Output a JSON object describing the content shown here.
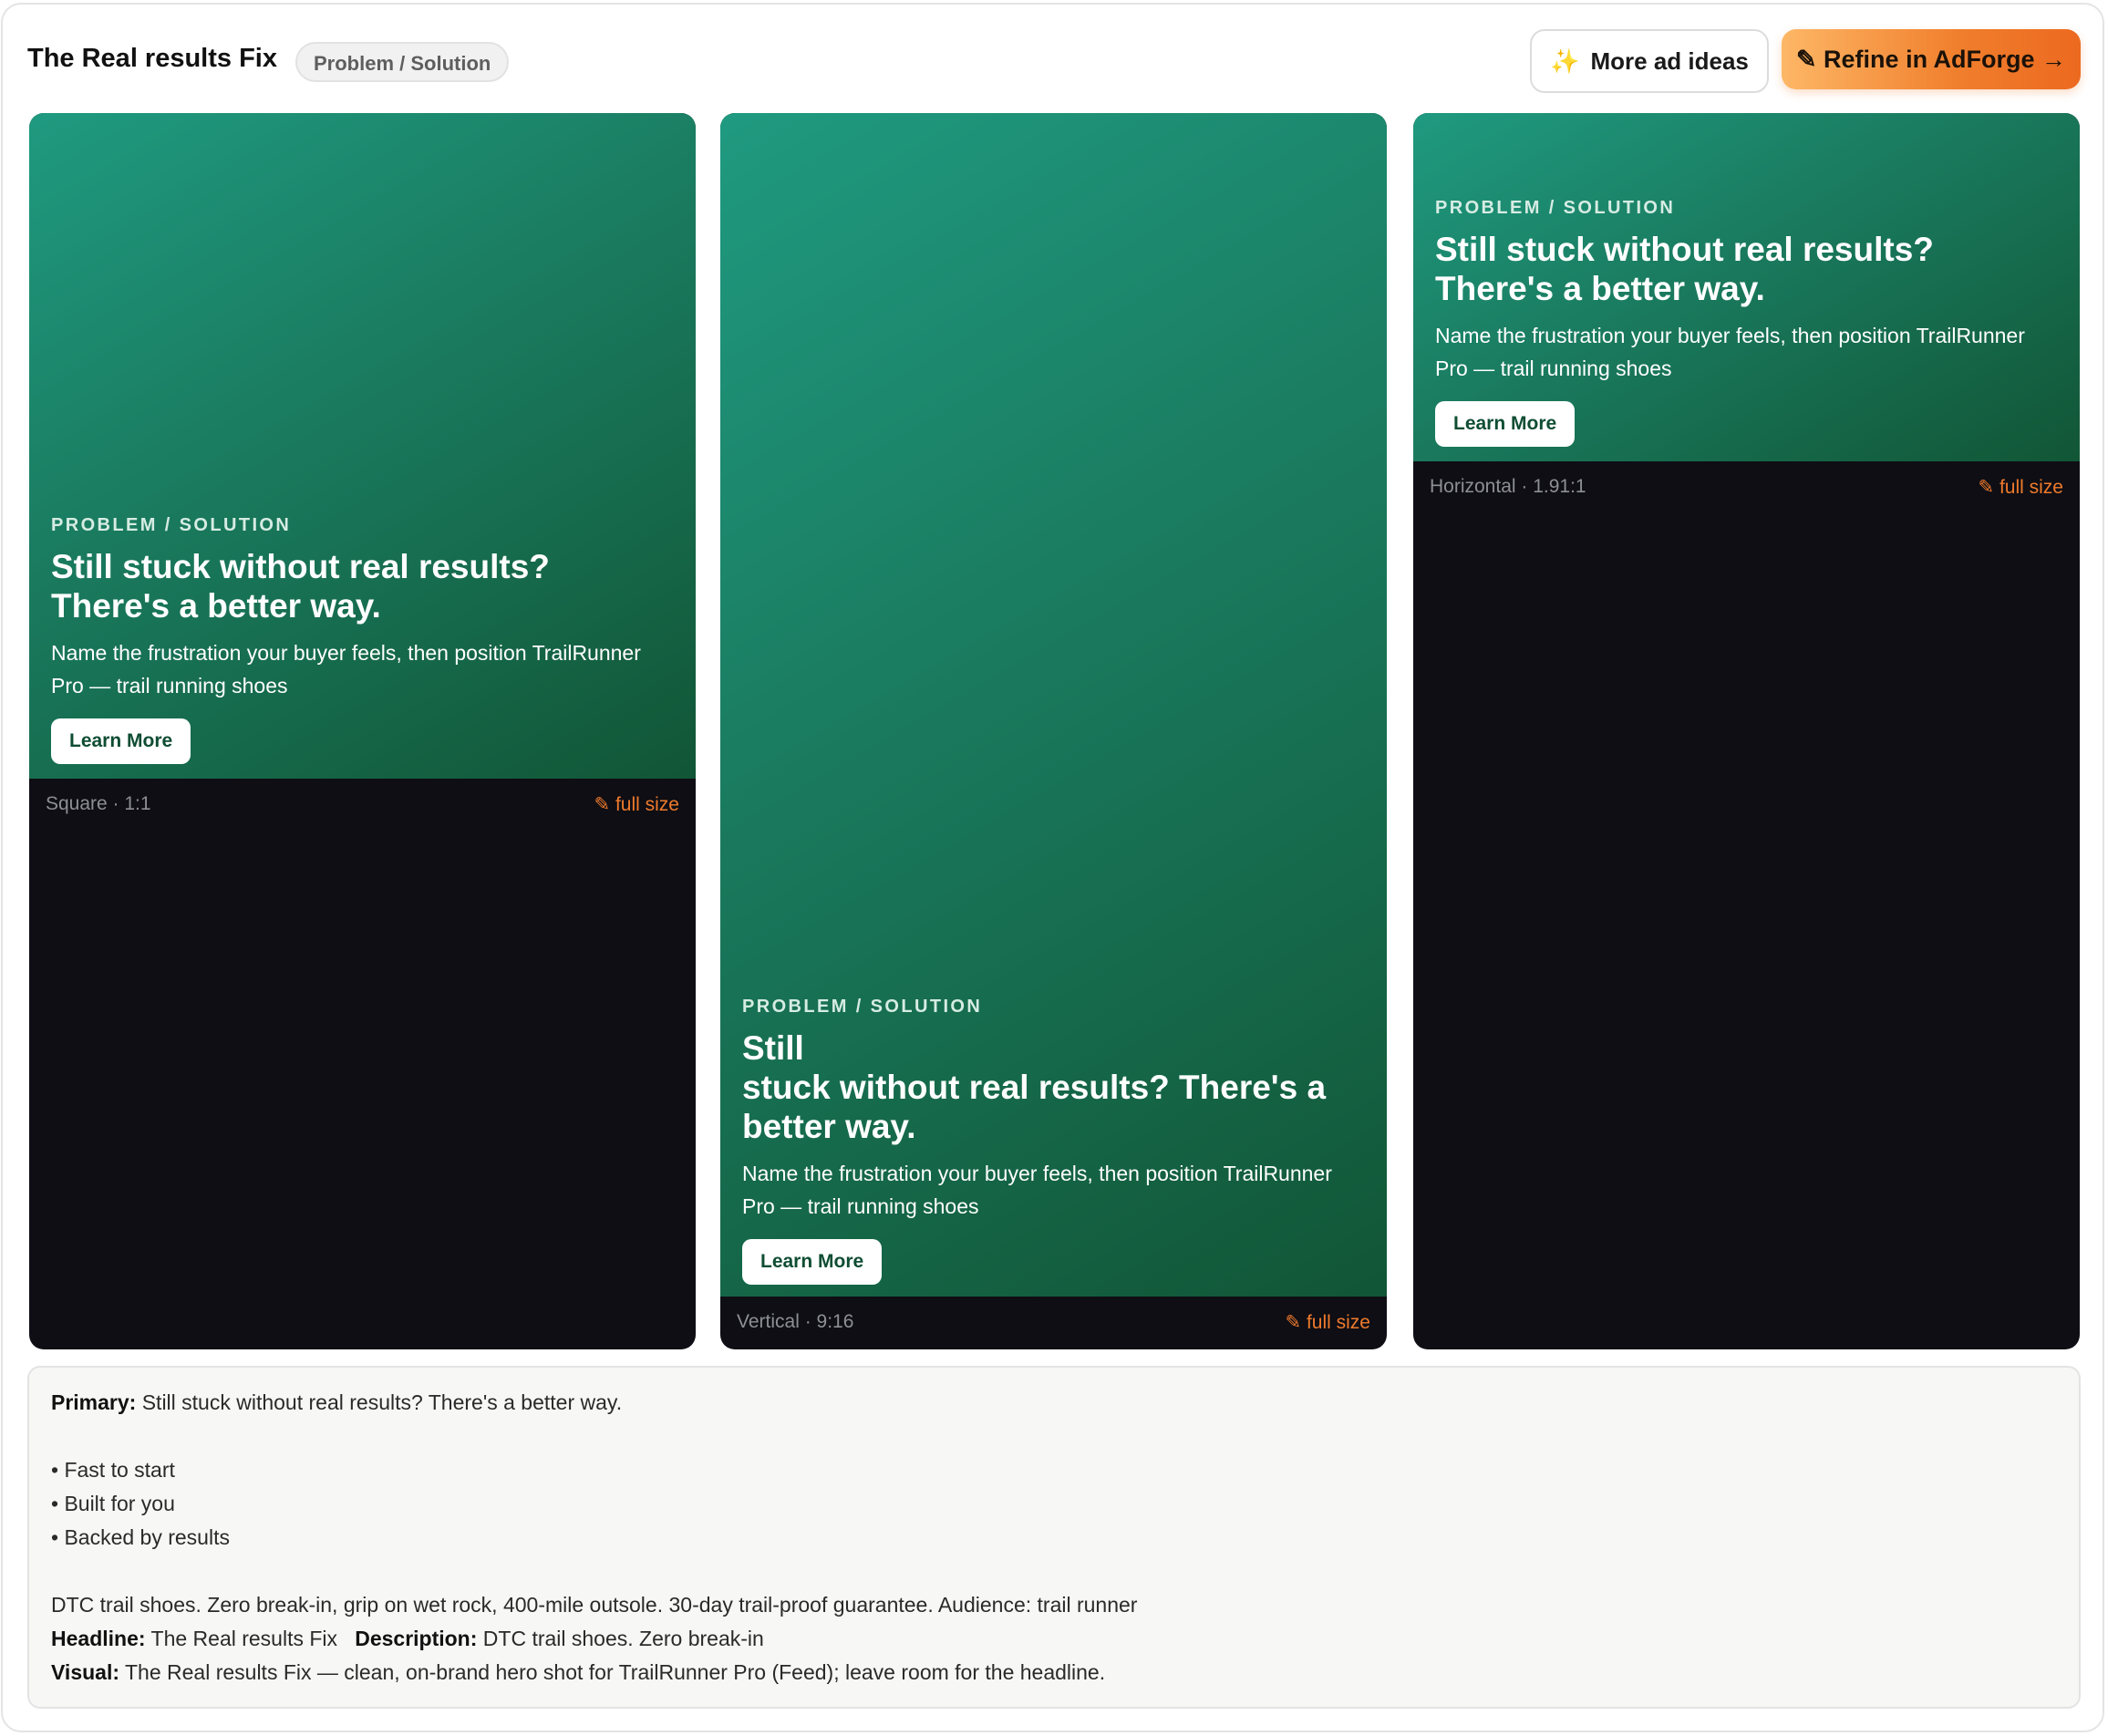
{
  "header": {
    "title": "The Real results Fix",
    "badge": "Problem / Solution",
    "more_ideas_icon": "✨",
    "more_ideas_label": "More ad ideas",
    "refine_label": "✎ Refine in AdForge →"
  },
  "cards": [
    {
      "eyebrow": "PROBLEM / SOLUTION",
      "headline": "Still stuck without real results? There's a better way.",
      "subtext": "Name the frustration your buyer feels, then position TrailRunner Pro — trail running shoes",
      "cta": "Learn More",
      "format_label": "Square · 1:1",
      "full_size_link": "✎ full size"
    },
    {
      "eyebrow": "PROBLEM / SOLUTION",
      "headline_line1": "Still",
      "headline_line2": "stuck without real results? There's a better way.",
      "subtext": "Name the frustration your buyer feels, then position TrailRunner Pro — trail running shoes",
      "cta": "Learn More",
      "format_label": "Vertical · 9:16",
      "full_size_link": "✎ full size"
    },
    {
      "eyebrow": "PROBLEM / SOLUTION",
      "headline": "Still stuck without real results? There's a better way.",
      "subtext": "Name the frustration your buyer feels, then position TrailRunner Pro — trail running shoes",
      "cta": "Learn More",
      "format_label": "Horizontal · 1.91:1",
      "full_size_link": "✎ full size"
    }
  ],
  "copy": {
    "primary_label": "Primary:",
    "primary_text": "Still stuck without real results? There's a better way.",
    "bullets": [
      "• Fast to start",
      "• Built for you",
      "• Backed by results"
    ],
    "body": "DTC trail shoes. Zero break-in, grip on wet rock, 400-mile outsole. 30-day trail-proof guarantee. Audience: trail runner",
    "headline_label": "Headline:",
    "headline_text": "The Real results Fix",
    "description_label": "Description:",
    "description_text": "DTC trail shoes. Zero break-in",
    "visual_label": "Visual:",
    "visual_text": "The Real results Fix — clean, on-brand hero shot for TrailRunner Pro (Feed); leave room for the headline."
  },
  "colors": {
    "accent_orange": "#ef7a2c",
    "creative_green": "#1a7a5e",
    "card_dark": "#0e0e14"
  }
}
